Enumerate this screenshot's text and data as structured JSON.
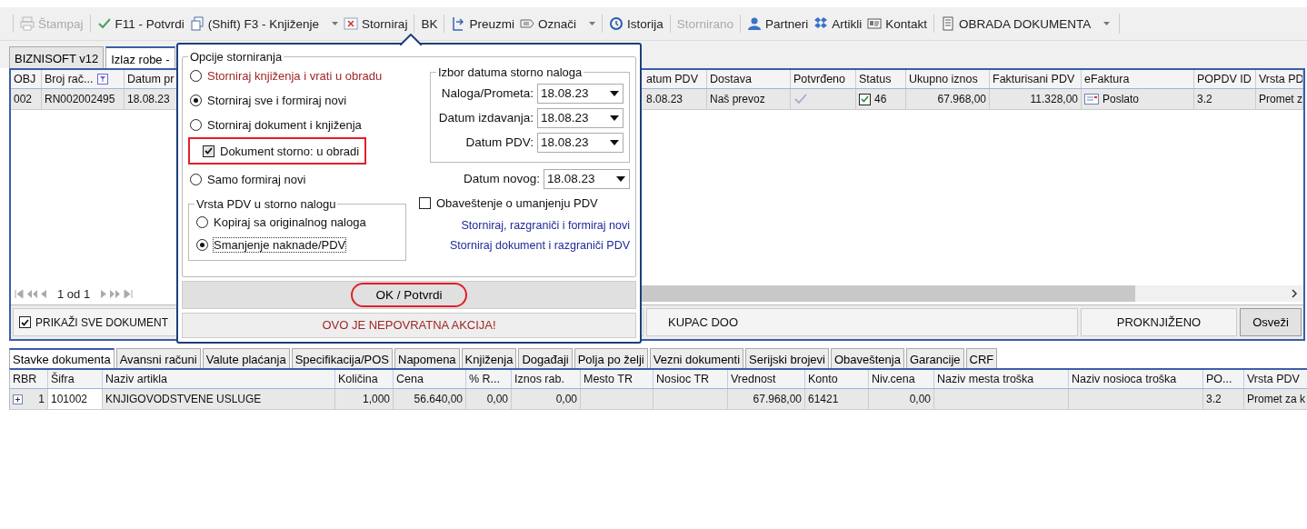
{
  "toolbar": [
    {
      "label": "Štampaj",
      "disabled": true,
      "dropdown": false
    },
    {
      "label": "F11 - Potvrdi",
      "disabled": false,
      "dropdown": false
    },
    {
      "label": "(Shift) F3 - Knjiženje",
      "disabled": false,
      "dropdown": true
    },
    {
      "label": "Storniraj",
      "disabled": false,
      "dropdown": false
    },
    {
      "label": "BK",
      "disabled": false,
      "dropdown": false
    },
    {
      "label": "Preuzmi",
      "disabled": false,
      "dropdown": false
    },
    {
      "label": "Označi",
      "disabled": false,
      "dropdown": true
    },
    {
      "label": "Istorija",
      "disabled": false,
      "dropdown": false
    },
    {
      "label": "Stornirano",
      "disabled": true,
      "dropdown": false
    },
    {
      "label": "Partneri",
      "disabled": false,
      "dropdown": false
    },
    {
      "label": "Artikli",
      "disabled": false,
      "dropdown": false
    },
    {
      "label": "Kontakt",
      "disabled": false,
      "dropdown": false
    },
    {
      "label": "OBRADA DOKUMENTA",
      "disabled": false,
      "dropdown": true
    }
  ],
  "doc_tabs": [
    {
      "label": "BIZNISOFT v12",
      "selected": false
    },
    {
      "label": "Izlaz robe -",
      "selected": true
    }
  ],
  "documents": {
    "columns": [
      {
        "label": "OBJ"
      },
      {
        "label": "Broj rač...",
        "filter": true
      },
      {
        "label": "Datum pr"
      },
      {
        "label": "atum PDV"
      },
      {
        "label": "Dostava"
      },
      {
        "label": "Potvrđeno"
      },
      {
        "label": "Status"
      },
      {
        "label": "Ukupno iznos"
      },
      {
        "label": "Fakturisani PDV"
      },
      {
        "label": "eFaktura"
      },
      {
        "label": "POPDV ID"
      },
      {
        "label": "Vrsta PD"
      }
    ],
    "rows": [
      {
        "cells": [
          {
            "kind": "text",
            "text": "002"
          },
          {
            "kind": "text",
            "text": "RN002002495"
          },
          {
            "kind": "text",
            "text": "18.08.23"
          },
          {
            "kind": "text",
            "text": "8.08.23"
          },
          {
            "kind": "text",
            "text": "Naš prevoz"
          },
          {
            "kind": "check",
            "checked": true
          },
          {
            "kind": "checkbox",
            "checked": true,
            "text": "46"
          },
          {
            "kind": "number",
            "text": "67.968,00"
          },
          {
            "kind": "number",
            "text": "11.328,00"
          },
          {
            "kind": "doc",
            "text": "Poslato"
          },
          {
            "kind": "text",
            "text": "3.2"
          },
          {
            "kind": "text",
            "text": "Promet z"
          }
        ]
      }
    ],
    "pager": "1 od 1"
  },
  "filter_bar": {
    "show_all": {
      "label": "PRIKAŽI SVE DOKUMENT",
      "checked": true
    },
    "customer": "KUPAC DOO",
    "status": "PROKNJIŽENO",
    "refresh": "Osveži"
  },
  "detail_tabs": [
    {
      "label": "Stavke dokumenta",
      "selected": true
    },
    {
      "label": "Avansni računi",
      "selected": false
    },
    {
      "label": "Valute plaćanja",
      "selected": false
    },
    {
      "label": "Specifikacija/POS",
      "selected": false
    },
    {
      "label": "Napomena",
      "selected": false
    },
    {
      "label": "Knjiženja",
      "selected": false
    },
    {
      "label": "Događaji",
      "selected": false
    },
    {
      "label": "Polja po želji",
      "selected": false
    },
    {
      "label": "Vezni dokumenti",
      "selected": false
    },
    {
      "label": "Serijski brojevi",
      "selected": false
    },
    {
      "label": "Obaveštenja",
      "selected": false
    },
    {
      "label": "Garancije",
      "selected": false
    },
    {
      "label": "CRF",
      "selected": false
    }
  ],
  "items": {
    "columns": [
      "RBR",
      "Šifra",
      "Naziv artikla",
      "Količina",
      "Cena",
      "% R...",
      "Iznos rab.",
      "Mesto TR",
      "Nosioc TR",
      "Vrednost",
      "Konto",
      "Niv.cena",
      "Naziv mesta troška",
      "Naziv nosioca troška",
      "PO...",
      "Vrsta PDV"
    ],
    "rows": [
      {
        "expanded": false,
        "cells": [
          "1",
          "101002",
          "KNJIGOVODSTVENE USLUGE",
          "1,000",
          "56.640,00",
          "0,00",
          "0,00",
          null,
          null,
          "67.968,00",
          "61421",
          "0,00",
          null,
          null,
          "3.2",
          "Promet za k"
        ]
      }
    ]
  },
  "storno_popup": {
    "group_title": "Opcije storniranja",
    "options": [
      {
        "kind": "radio",
        "label": "Storniraj knjiženja i vrati u obradu",
        "selected": false,
        "danger": true,
        "highlighted": false
      },
      {
        "kind": "radio",
        "label": "Storniraj sve i formiraj novi",
        "selected": true,
        "danger": false,
        "highlighted": false
      },
      {
        "kind": "radio",
        "label": "Storniraj dokument i knjiženja",
        "selected": false,
        "danger": false,
        "highlighted": false
      },
      {
        "kind": "checkbox",
        "label": "Dokument storno: u obradi",
        "checked": true,
        "danger": false,
        "highlighted": true
      },
      {
        "kind": "radio",
        "label": "Samo formiraj novi",
        "selected": false,
        "danger": false,
        "highlighted": false
      }
    ],
    "vat_group": {
      "title": "Vrsta PDV u storno nalogu",
      "options": [
        {
          "label": "Kopiraj sa originalnog naloga",
          "selected": false
        },
        {
          "label": "Smanjenje naknade/PDV",
          "selected": true
        }
      ]
    },
    "date_group": {
      "title": "Izbor datuma storno naloga",
      "fields": [
        {
          "label": "Naloga/Prometa:",
          "value": "18.08.23"
        },
        {
          "label": "Datum izdavanja:",
          "value": "18.08.23"
        },
        {
          "label": "Datum PDV:",
          "value": "18.08.23"
        }
      ]
    },
    "new_date": {
      "label": "Datum novog:",
      "value": "18.08.23"
    },
    "notice": {
      "label": "Obaveštenje o umanjenju PDV",
      "checked": false
    },
    "links": [
      "Storniraj, razgraniči i formiraj novi",
      "Storniraj dokument i razgraniči PDV"
    ],
    "ok_button": {
      "label": "OK / Potvrdi",
      "highlighted": true
    },
    "warning": "OVO JE NEPOVRATNA AKCIJA!"
  }
}
